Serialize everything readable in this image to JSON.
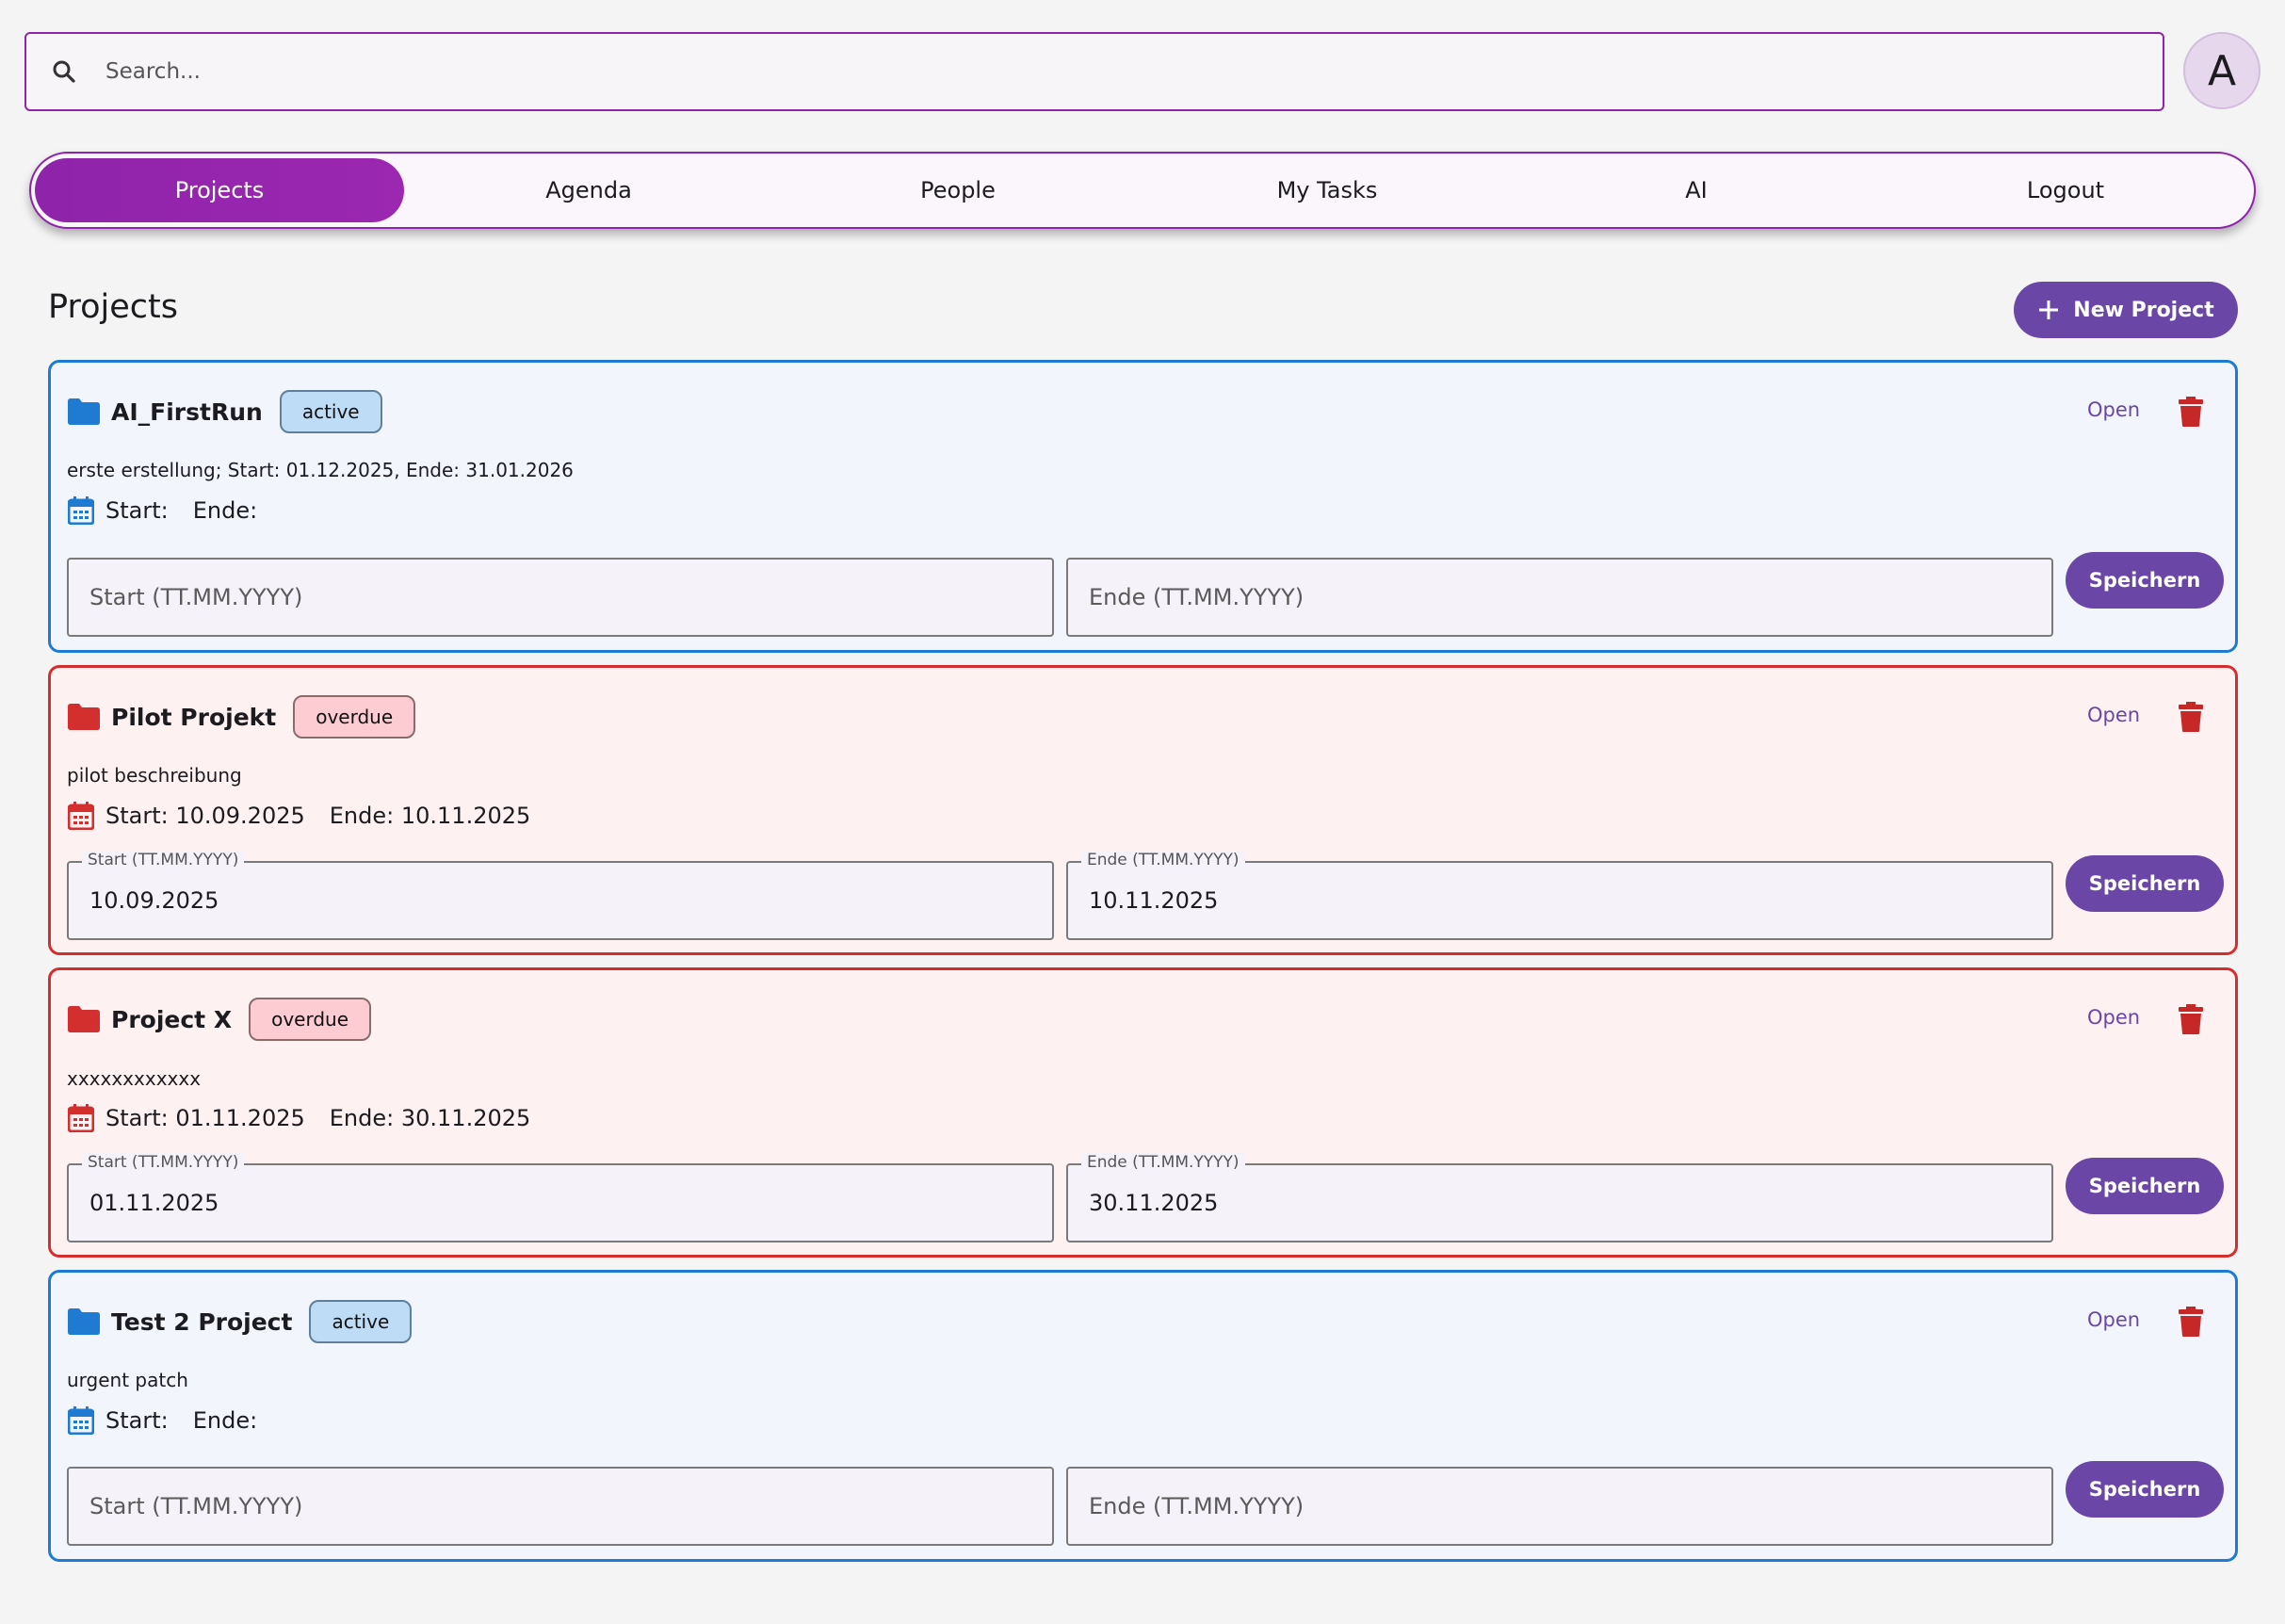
{
  "search": {
    "placeholder": "Search..."
  },
  "user": {
    "avatar_letter": "A"
  },
  "nav": {
    "tabs": [
      {
        "label": "Projects",
        "active": true
      },
      {
        "label": "Agenda",
        "active": false
      },
      {
        "label": "People",
        "active": false
      },
      {
        "label": "My Tasks",
        "active": false
      },
      {
        "label": "AI",
        "active": false
      },
      {
        "label": "Logout",
        "active": false
      }
    ]
  },
  "page": {
    "title": "Projects",
    "new_project_label": "New Project"
  },
  "labels": {
    "open": "Open",
    "save": "Speichern",
    "start_placeholder": "Start (TT.MM.YYYY)",
    "end_placeholder": "Ende (TT.MM.YYYY)",
    "start_label": "Start (TT.MM.YYYY)",
    "end_label": "Ende (TT.MM.YYYY)"
  },
  "projects": [
    {
      "name": "AI_FirstRun",
      "status": "active",
      "description": "erste erstellung; Start: 01.12.2025, Ende: 31.01.2026",
      "start_text": "Start:",
      "end_text": "Ende:",
      "start_value": "",
      "end_value": ""
    },
    {
      "name": "Pilot Projekt",
      "status": "overdue",
      "description": "pilot beschreibung",
      "start_text": "Start: 10.09.2025",
      "end_text": "Ende: 10.11.2025",
      "start_value": "10.09.2025",
      "end_value": "10.11.2025"
    },
    {
      "name": "Project X",
      "status": "overdue",
      "description": "xxxxxxxxxxxx",
      "start_text": "Start: 01.11.2025",
      "end_text": "Ende: 30.11.2025",
      "start_value": "01.11.2025",
      "end_value": "30.11.2025"
    },
    {
      "name": "Test 2 Project",
      "status": "active",
      "description": "urgent patch",
      "start_text": "Start:",
      "end_text": "Ende:",
      "start_value": "",
      "end_value": ""
    }
  ],
  "colors": {
    "accent": "#8e24aa",
    "primary_button": "#6a47a6",
    "active_border": "#1e7bd1",
    "overdue_border": "#d32f2f",
    "trash": "#c62828"
  },
  "icons": {
    "search": "search-icon",
    "folder": "folder-icon",
    "calendar": "calendar-icon",
    "trash": "trash-icon",
    "plus": "plus-icon"
  }
}
